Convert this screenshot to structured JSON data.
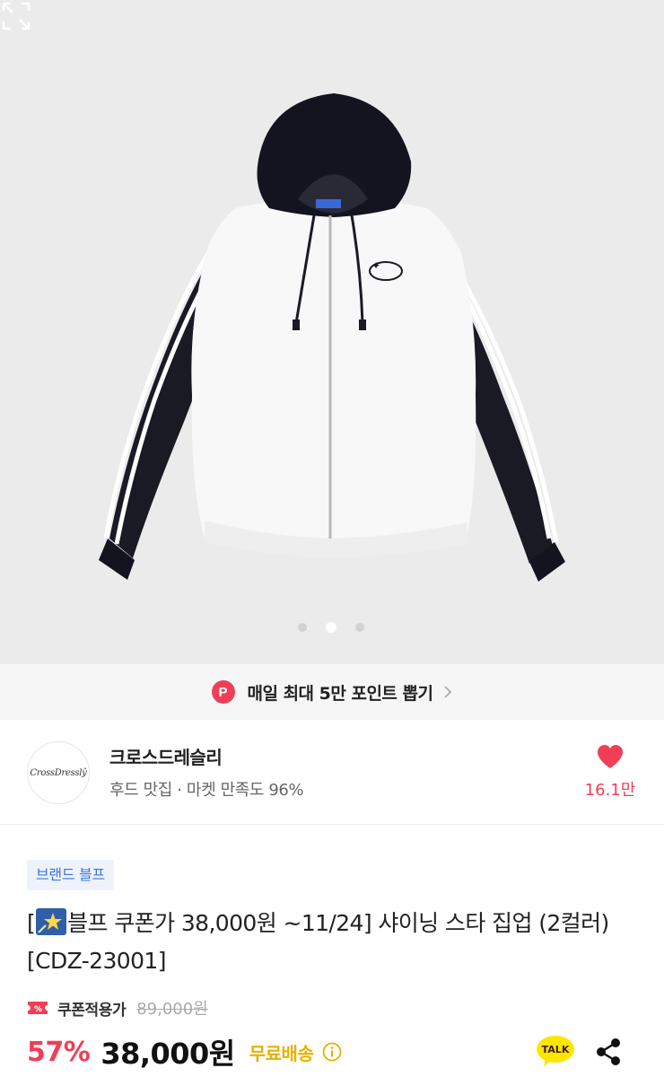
{
  "gallery": {
    "slide_count": 3,
    "active_index": 1,
    "product_image": "hoodie-zipup-photo",
    "expand_icon": "expand-icon"
  },
  "points_banner": {
    "badge": "P",
    "text": "매일 최대 5만 포인트 뽑기",
    "icon": "chevron-right-icon"
  },
  "brand": {
    "logo_text": "CrossDresslŷ",
    "name": "크로스드레슬리",
    "subtitle": "후드 맛집 · 마켓 만족도 96%",
    "like_count": "16.1만",
    "like_icon": "heart-icon"
  },
  "product": {
    "tag": "브랜드 블프",
    "title_prefix": "[",
    "title_text": "블프 쿠폰가 38,000원 ~11/24] 샤이닝 스타 집업 (2컬러) [CDZ-23001]",
    "coupon_label": "쿠폰적용가",
    "original_price": "89,000원",
    "discount": "57%",
    "price": "38,000원",
    "shipping": "무료배송"
  },
  "actions": {
    "talk_label": "TALK",
    "share_icon": "share-icon"
  },
  "colors": {
    "accent_red": "#ef3f57",
    "tag_blue": "#3d74e0",
    "shipping_yellow": "#e5b100",
    "kakao_yellow": "#fee500"
  }
}
